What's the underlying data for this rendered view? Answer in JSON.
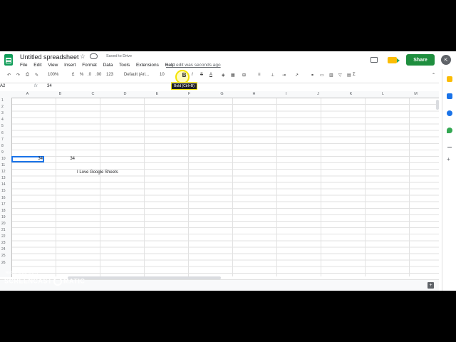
{
  "app": {
    "doc_title": "Untitled spreadsheet",
    "saved_status": "Saved to Drive",
    "menu": [
      "File",
      "Edit",
      "View",
      "Insert",
      "Format",
      "Data",
      "Tools",
      "Extensions",
      "Help"
    ],
    "last_edit": "Last edit was seconds ago",
    "share_label": "Share",
    "avatar_initial": "K"
  },
  "toolbar": {
    "zoom": "100%",
    "currency": "£",
    "percent": "%",
    "dec_dec": ".0",
    "dec_inc": ".00",
    "more_formats": "123",
    "font": "Default (Ari...",
    "font_size": "10",
    "bold": "B",
    "italic": "I",
    "strike": "S",
    "text_color": "A",
    "tooltip": "Bold (Ctrl+B)"
  },
  "formula_bar": {
    "name_box": "A2",
    "fx": "fx",
    "value": "34"
  },
  "sheet": {
    "columns": [
      "A",
      "B",
      "C",
      "D",
      "E",
      "F",
      "G",
      "H",
      "I",
      "J",
      "K",
      "L",
      "M"
    ],
    "rows": [
      "1",
      "2",
      "3",
      "4",
      "5",
      "6",
      "7",
      "8",
      "9",
      "10",
      "11",
      "12",
      "13",
      "14",
      "15",
      "16",
      "17",
      "18",
      "19",
      "20",
      "21",
      "22",
      "23",
      "24",
      "25",
      "26"
    ],
    "cells": {
      "A2": "34",
      "B2": "34",
      "C4": "I Love Google Sheets"
    }
  },
  "watermark": {
    "line1": "RECORDED WITH",
    "line2_left": "SCREENCAST",
    "line2_right": "MATIC"
  }
}
